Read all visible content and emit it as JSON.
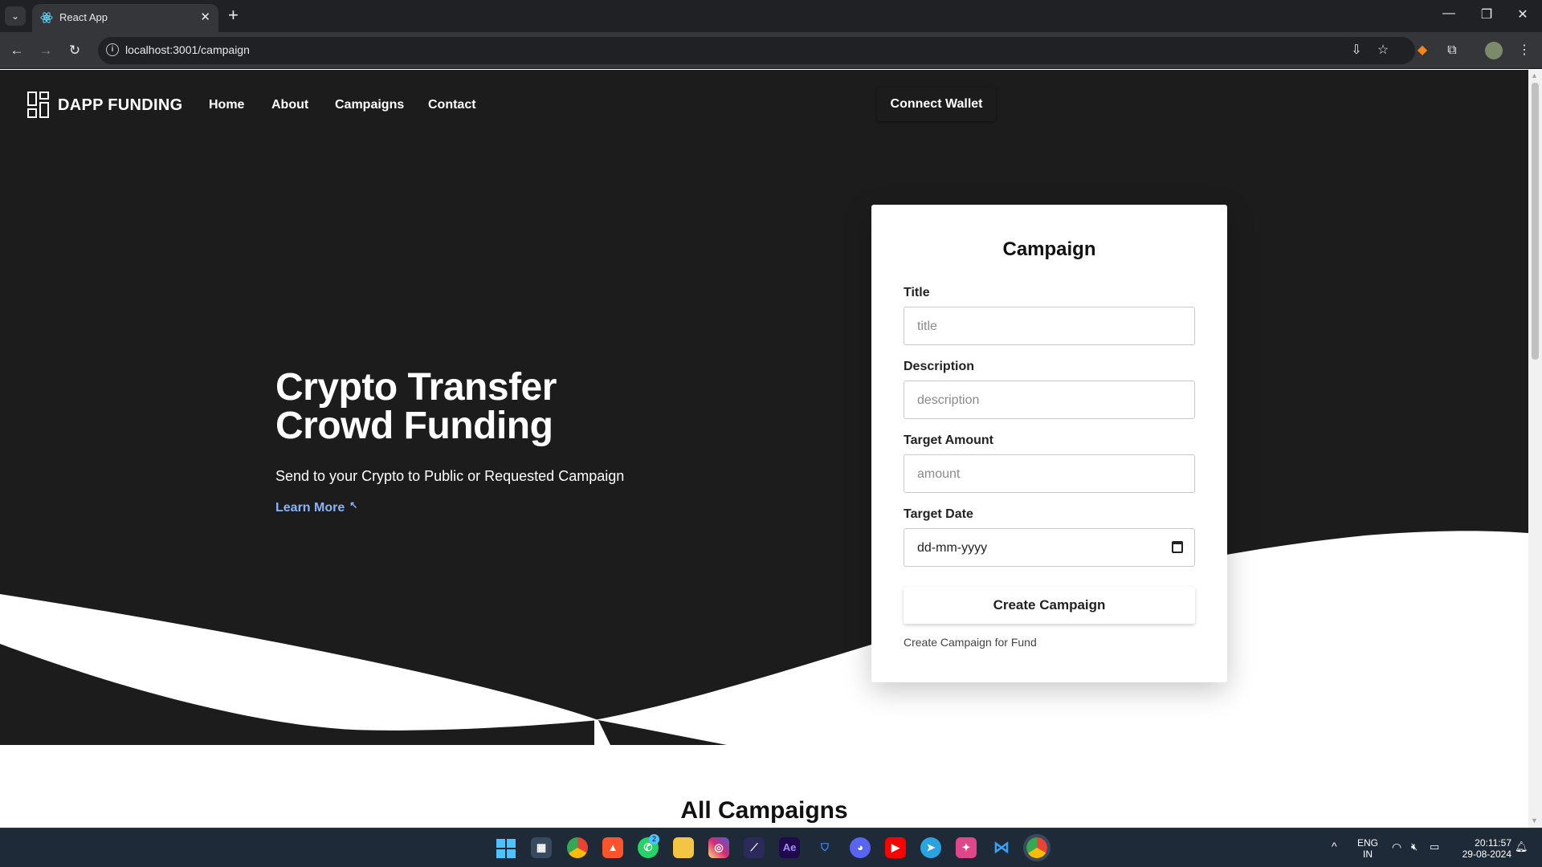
{
  "browser": {
    "tab_title": "React App",
    "url": "localhost:3001/campaign",
    "tab_close": "✕",
    "new_tab": "+",
    "tab_list": "⌄"
  },
  "nav": {
    "brand": "DAPP FUNDING",
    "links": [
      "Home",
      "About",
      "Campaigns",
      "Contact"
    ],
    "connect_wallet": "Connect Wallet"
  },
  "hero": {
    "title_line1": "Crypto Transfer",
    "title_line2": "Crowd Funding",
    "subtitle": "Send to your Crypto to Public or Requested Campaign",
    "learn_more": "Learn More"
  },
  "form": {
    "heading": "Campaign",
    "fields": [
      {
        "label": "Title",
        "placeholder": "title"
      },
      {
        "label": "Description",
        "placeholder": "description"
      },
      {
        "label": "Target Amount",
        "placeholder": "amount"
      },
      {
        "label": "Target Date",
        "value": "dd-mm-yyyy"
      }
    ],
    "submit": "Create Campaign",
    "footnote": "Create Campaign for Fund"
  },
  "section": {
    "all_campaigns": "All Campaigns"
  },
  "taskbar": {
    "whatsapp_badge": "2",
    "lang": "ENG",
    "region": "IN",
    "time": "20:11:57",
    "date": "29-08-2024"
  },
  "colors": {
    "hero_bg": "#1c1c1c",
    "link_blue": "#8ab4f8",
    "taskbar_bg": "#1f2a38"
  }
}
